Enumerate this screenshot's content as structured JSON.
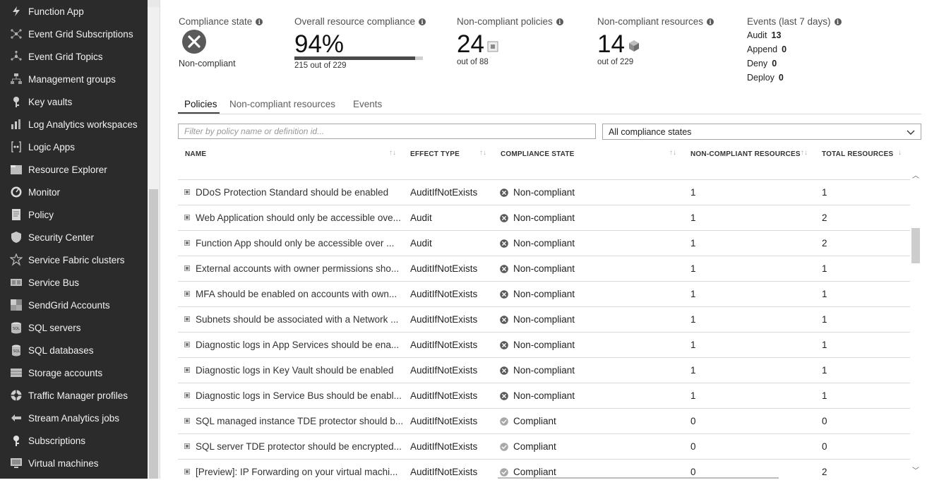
{
  "sidebar": {
    "items": [
      {
        "label": "Function App",
        "icon": "function-app-icon"
      },
      {
        "label": "Event Grid Subscriptions",
        "icon": "event-grid-subscriptions-icon"
      },
      {
        "label": "Event Grid Topics",
        "icon": "event-grid-topics-icon"
      },
      {
        "label": "Management groups",
        "icon": "management-groups-icon"
      },
      {
        "label": "Key vaults",
        "icon": "key-vault-icon"
      },
      {
        "label": "Log Analytics workspaces",
        "icon": "log-analytics-icon"
      },
      {
        "label": "Logic Apps",
        "icon": "logic-apps-icon"
      },
      {
        "label": "Resource Explorer",
        "icon": "resource-explorer-icon"
      },
      {
        "label": "Monitor",
        "icon": "monitor-icon"
      },
      {
        "label": "Policy",
        "icon": "policy-icon"
      },
      {
        "label": "Security Center",
        "icon": "security-center-icon"
      },
      {
        "label": "Service Fabric clusters",
        "icon": "service-fabric-icon"
      },
      {
        "label": "Service Bus",
        "icon": "service-bus-icon"
      },
      {
        "label": "SendGrid Accounts",
        "icon": "sendgrid-icon"
      },
      {
        "label": "SQL servers",
        "icon": "sql-server-icon"
      },
      {
        "label": "SQL databases",
        "icon": "sql-database-icon"
      },
      {
        "label": "Storage accounts",
        "icon": "storage-accounts-icon"
      },
      {
        "label": "Traffic Manager profiles",
        "icon": "traffic-manager-icon"
      },
      {
        "label": "Stream Analytics jobs",
        "icon": "stream-analytics-icon"
      },
      {
        "label": "Subscriptions",
        "icon": "subscriptions-icon"
      },
      {
        "label": "Virtual machines",
        "icon": "virtual-machines-icon"
      }
    ]
  },
  "summary": {
    "compliance_state": {
      "label": "Compliance state",
      "value": "Non-compliant"
    },
    "overall": {
      "label": "Overall resource compliance",
      "value": "94%",
      "detail": "215 out of 229",
      "fraction": 0.94
    },
    "noncompliant_policies": {
      "label": "Non-compliant policies",
      "value": "24",
      "detail": "out of 88"
    },
    "noncompliant_resources": {
      "label": "Non-compliant resources",
      "value": "14",
      "detail": "out of 229"
    },
    "events": {
      "label": "Events (last 7 days)",
      "rows": [
        {
          "name": "Audit",
          "count": "13"
        },
        {
          "name": "Append",
          "count": "0"
        },
        {
          "name": "Deny",
          "count": "0"
        },
        {
          "name": "Deploy",
          "count": "0"
        }
      ]
    }
  },
  "tabs": [
    "Policies",
    "Non-compliant resources",
    "Events"
  ],
  "filter": {
    "placeholder": "Filter by policy name or definition id...",
    "state_selected": "All compliance states"
  },
  "table": {
    "headers": {
      "name": "NAME",
      "effect": "EFFECT TYPE",
      "state": "COMPLIANCE STATE",
      "noncompliant": "NON-COMPLIANT RESOURCES",
      "total": "TOTAL RESOURCES"
    },
    "rows": [
      {
        "name": "DDoS Protection Standard should be enabled",
        "effect": "AuditIfNotExists",
        "state": "Non-compliant",
        "noncompliant": "1",
        "total": "1"
      },
      {
        "name": "Web Application should only be accessible ove...",
        "effect": "Audit",
        "state": "Non-compliant",
        "noncompliant": "1",
        "total": "2"
      },
      {
        "name": "Function App should only be accessible over ...",
        "effect": "Audit",
        "state": "Non-compliant",
        "noncompliant": "1",
        "total": "2"
      },
      {
        "name": "External accounts with owner permissions sho...",
        "effect": "AuditIfNotExists",
        "state": "Non-compliant",
        "noncompliant": "1",
        "total": "1"
      },
      {
        "name": "MFA should be enabled on accounts with own...",
        "effect": "AuditIfNotExists",
        "state": "Non-compliant",
        "noncompliant": "1",
        "total": "1"
      },
      {
        "name": "Subnets should be associated with a Network ...",
        "effect": "AuditIfNotExists",
        "state": "Non-compliant",
        "noncompliant": "1",
        "total": "1"
      },
      {
        "name": "Diagnostic logs in App Services should be ena...",
        "effect": "AuditIfNotExists",
        "state": "Non-compliant",
        "noncompliant": "1",
        "total": "1"
      },
      {
        "name": "Diagnostic logs in Key Vault should be enabled",
        "effect": "AuditIfNotExists",
        "state": "Non-compliant",
        "noncompliant": "1",
        "total": "1"
      },
      {
        "name": "Diagnostic logs in Service Bus should be enabl...",
        "effect": "AuditIfNotExists",
        "state": "Non-compliant",
        "noncompliant": "1",
        "total": "1"
      },
      {
        "name": "SQL managed instance TDE protector should b...",
        "effect": "AuditIfNotExists",
        "state": "Compliant",
        "noncompliant": "0",
        "total": "0"
      },
      {
        "name": "SQL server TDE protector should be encrypted...",
        "effect": "AuditIfNotExists",
        "state": "Compliant",
        "noncompliant": "0",
        "total": "0"
      },
      {
        "name": "[Preview]: IP Forwarding on your virtual machi...",
        "effect": "AuditIfNotExists",
        "state": "Compliant",
        "noncompliant": "0",
        "total": "2"
      }
    ]
  }
}
